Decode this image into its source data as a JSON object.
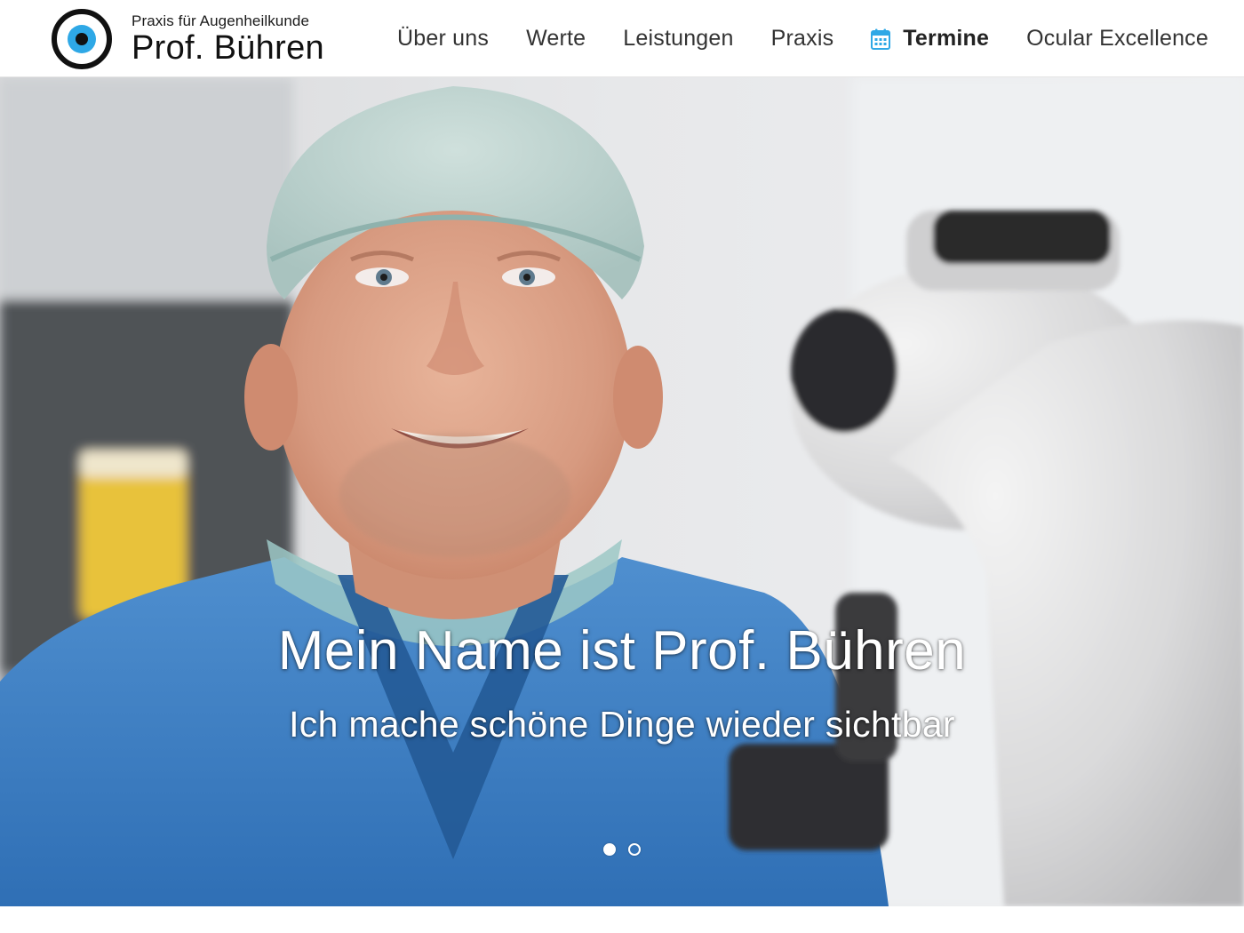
{
  "brand": {
    "subtitle": "Praxis für Augenheilkunde",
    "name": "Prof. Bühren",
    "logo_icon": "eye-logo-icon",
    "logo_accent": "#2ea8e6"
  },
  "nav": {
    "items": [
      {
        "label": "Über uns"
      },
      {
        "label": "Werte"
      },
      {
        "label": "Leistungen"
      },
      {
        "label": "Praxis"
      },
      {
        "label": "Termine",
        "icon": "calendar-icon",
        "active": true
      },
      {
        "label": "Ocular Excellence"
      }
    ],
    "icon_color": "#2ea8e6"
  },
  "hero": {
    "title": "Mein Name ist Prof. Bühren",
    "subtitle": "Ich mache schöne Dinge wieder sichtbar",
    "slides_total": 2,
    "active_slide": 1
  }
}
